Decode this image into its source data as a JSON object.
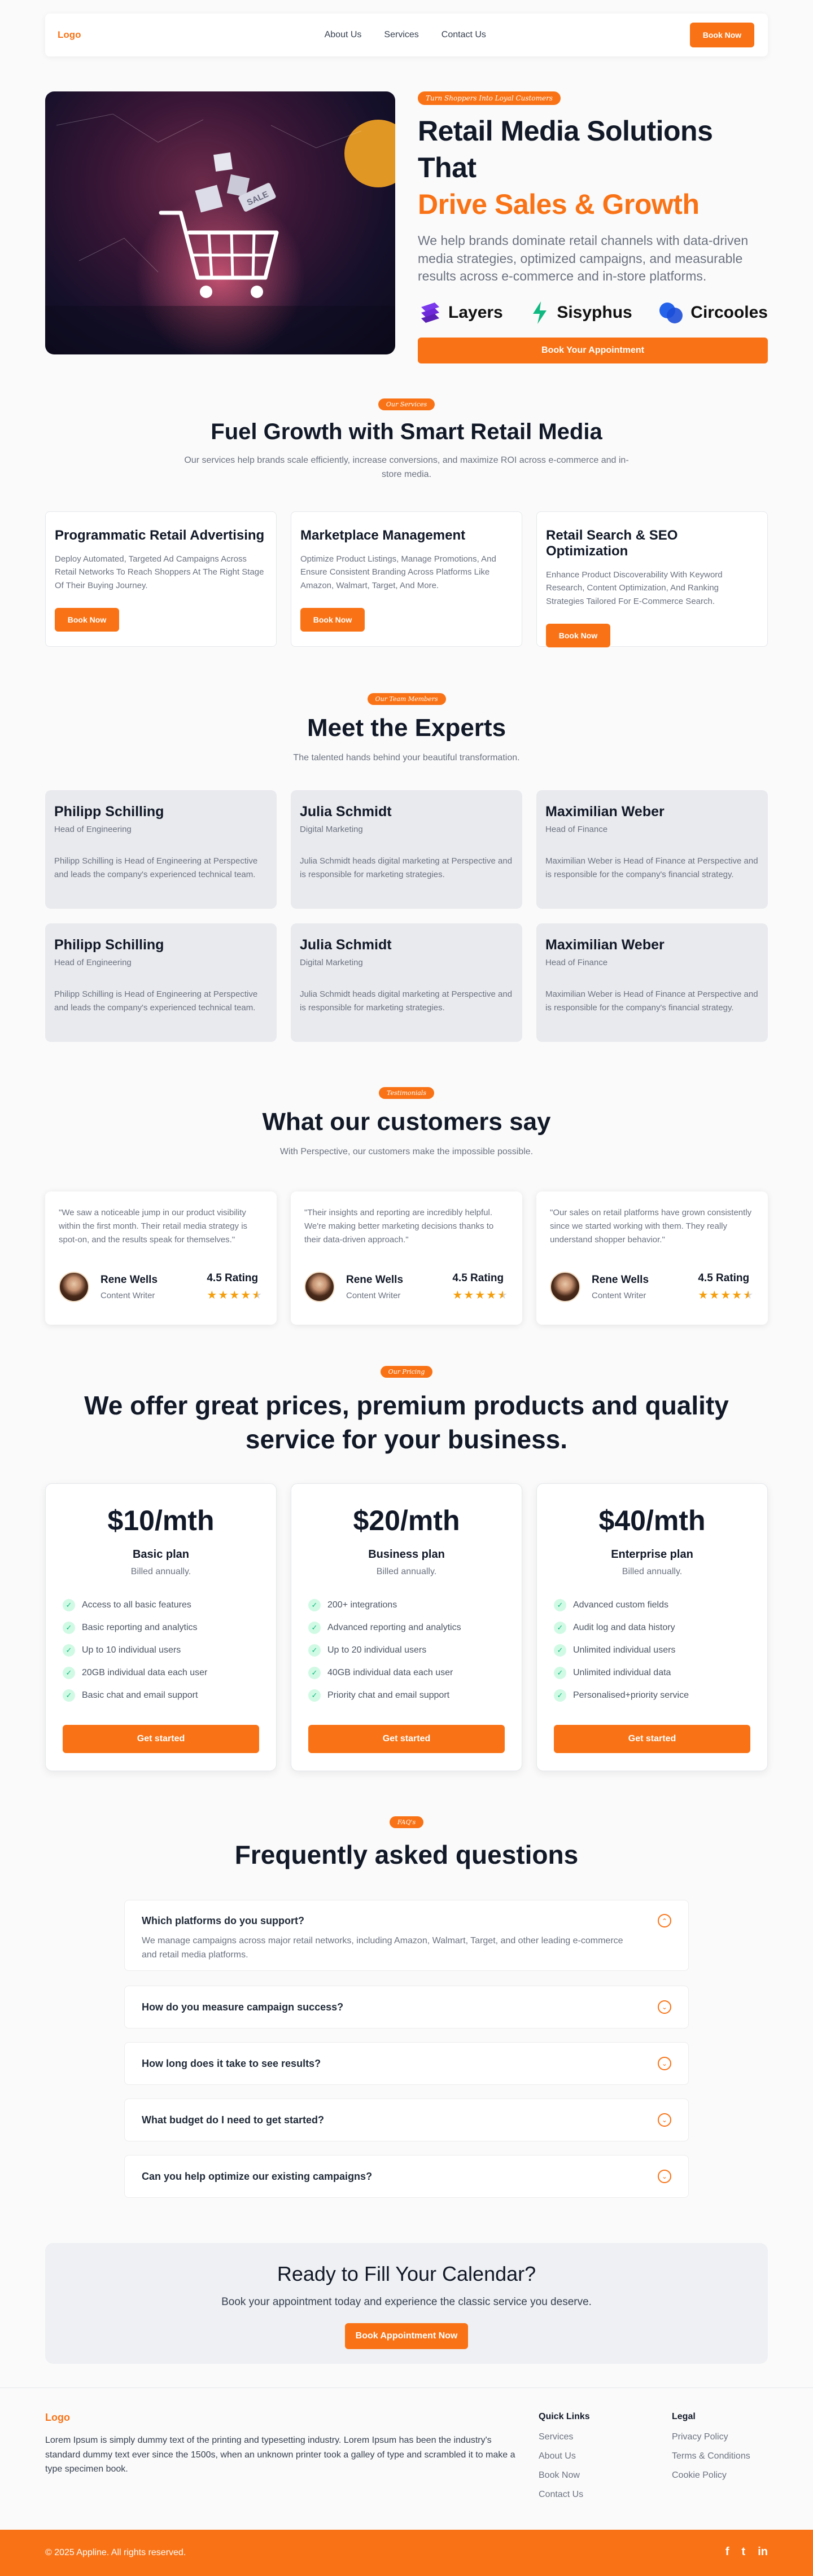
{
  "header": {
    "logo": "Logo",
    "nav": [
      "About Us",
      "Services",
      "Contact Us"
    ],
    "cta": "Book Now"
  },
  "hero": {
    "badge": "Turn Shoppers Into Loyal Customers",
    "title_line1": "Retail Media Solutions That",
    "title_line2": "Drive Sales & Growth",
    "description": "We help brands dominate retail channels with data-driven media strategies, optimized campaigns, and measurable results across e-commerce and in-store platforms.",
    "brands": [
      "Layers",
      "Sisyphus",
      "Circooles"
    ],
    "cta": "Book Your Appointment",
    "image_sale_tag": "SALE"
  },
  "services": {
    "badge": "Our Services",
    "title": "Fuel Growth with Smart Retail Media",
    "subtitle": "Our services help brands scale efficiently, increase conversions, and maximize ROI across e-commerce and in-store media.",
    "items": [
      {
        "title": "Programmatic Retail Advertising",
        "desc": "Deploy Automated, Targeted Ad Campaigns Across Retail Networks To Reach Shoppers At The Right Stage Of Their Buying Journey.",
        "cta": "Book Now"
      },
      {
        "title": "Marketplace Management",
        "desc": "Optimize Product Listings, Manage Promotions, And Ensure Consistent Branding Across Platforms Like Amazon, Walmart, Target, And More.",
        "cta": "Book Now"
      },
      {
        "title": "Retail Search & SEO Optimization",
        "desc": "Enhance Product Discoverability With Keyword Research, Content Optimization, And Ranking Strategies Tailored For E-Commerce Search.",
        "cta": "Book Now"
      }
    ]
  },
  "team": {
    "badge": "Our Team Members",
    "title": "Meet the Experts",
    "subtitle": "The talented hands behind your beautiful transformation.",
    "members": [
      {
        "name": "Philipp Schilling",
        "role": "Head of Engineering",
        "bio": "Philipp Schilling is Head of Engineering at Perspective and leads the company's experienced technical team."
      },
      {
        "name": "Julia Schmidt",
        "role": "Digital Marketing",
        "bio": "Julia Schmidt heads digital marketing at Perspective and is responsible for marketing strategies."
      },
      {
        "name": "Maximilian Weber",
        "role": "Head of Finance",
        "bio": "Maximilian Weber is Head of Finance at Perspective and is responsible for the company's financial strategy."
      },
      {
        "name": "Philipp Schilling",
        "role": "Head of Engineering",
        "bio": "Philipp Schilling is Head of Engineering at Perspective and leads the company's experienced technical team."
      },
      {
        "name": "Julia Schmidt",
        "role": "Digital Marketing",
        "bio": "Julia Schmidt heads digital marketing at Perspective and is responsible for marketing strategies."
      },
      {
        "name": "Maximilian Weber",
        "role": "Head of Finance",
        "bio": "Maximilian Weber is Head of Finance at Perspective and is responsible for the company's financial strategy."
      }
    ]
  },
  "testimonials": {
    "badge": "Testimonials",
    "title": "What our customers say",
    "subtitle": "With Perspective, our customers make the impossible possible.",
    "items": [
      {
        "quote": "\"We saw a noticeable jump in our product visibility within the first month. Their retail media strategy is spot-on, and the results speak for themselves.\"",
        "name": "Rene Wells",
        "title": "Content Writer",
        "rating_label": "4.5 Rating",
        "rating": 4.5
      },
      {
        "quote": "\"Their insights and reporting are incredibly helpful. We're making better marketing decisions thanks to their data-driven approach.\"",
        "name": "Rene Wells",
        "title": "Content Writer",
        "rating_label": "4.5 Rating",
        "rating": 4.5
      },
      {
        "quote": "\"Our sales on retail platforms have grown consistently since we started working with them. They really understand shopper behavior.\"",
        "name": "Rene Wells",
        "title": "Content Writer",
        "rating_label": "4.5 Rating",
        "rating": 4.5
      }
    ]
  },
  "pricing": {
    "badge": "Our Pricing",
    "title_line1": "We offer great prices, premium products and quality",
    "title_line2": "service for your business.",
    "plans": [
      {
        "price": "$10/mth",
        "name": "Basic plan",
        "billed": "Billed annually.",
        "features": [
          "Access to all basic features",
          "Basic reporting and analytics",
          "Up to 10 individual users",
          "20GB individual data each user",
          "Basic chat and email support"
        ],
        "cta": "Get started"
      },
      {
        "price": "$20/mth",
        "name": "Business plan",
        "billed": "Billed annually.",
        "features": [
          "200+ integrations",
          "Advanced reporting and analytics",
          "Up to 20 individual users",
          "40GB individual data each user",
          "Priority chat and email support"
        ],
        "cta": "Get started"
      },
      {
        "price": "$40/mth",
        "name": "Enterprise plan",
        "billed": "Billed annually.",
        "features": [
          "Advanced custom fields",
          "Audit log and data history",
          "Unlimited individual users",
          "Unlimited individual data",
          "Personalised+priority service"
        ],
        "cta": "Get started"
      }
    ]
  },
  "faq": {
    "badge": "FAQ's",
    "title": "Frequently asked questions",
    "items": [
      {
        "q": "Which platforms do you support?",
        "a": "We manage campaigns across major retail networks, including Amazon, Walmart, Target, and other leading e-commerce and retail media platforms.",
        "open": true
      },
      {
        "q": "How do you measure campaign success?",
        "a": "",
        "open": false
      },
      {
        "q": "How long does it take to see results?",
        "a": "",
        "open": false
      },
      {
        "q": "What budget do I need to get started?",
        "a": "",
        "open": false
      },
      {
        "q": "Can you help optimize our existing campaigns?",
        "a": "",
        "open": false
      }
    ]
  },
  "cta": {
    "title": "Ready to Fill Your Calendar?",
    "subtitle": "Book your appointment today and experience the classic service you deserve.",
    "button": "Book Appointment Now"
  },
  "footer": {
    "logo": "Logo",
    "description": "Lorem Ipsum is simply dummy text of the printing and typesetting industry. Lorem Ipsum has been the industry's standard dummy text ever since the 1500s, when an unknown printer took a galley of type and scrambled it to make a type specimen book.",
    "quick_links_title": "Quick Links",
    "quick_links": [
      "Services",
      "About Us",
      "Book Now",
      "Contact Us"
    ],
    "legal_title": "Legal",
    "legal": [
      "Privacy Policy",
      "Terms & Conditions",
      "Cookie Policy"
    ],
    "copyright": "© 2025 Appline. All rights reserved.",
    "social_icons": [
      "facebook-icon",
      "twitter-icon",
      "linkedin-icon"
    ],
    "social_glyphs": [
      "f",
      "t",
      "in"
    ]
  },
  "colors": {
    "accent": "#f97316",
    "text": "#111827",
    "muted": "#6b7280",
    "card_grey": "#e9eaee"
  }
}
